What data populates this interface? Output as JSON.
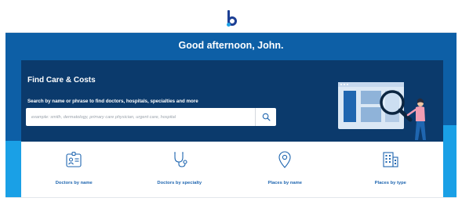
{
  "header": {
    "logo_text": "b"
  },
  "hero": {
    "greeting": "Good afternoon, John."
  },
  "find_care": {
    "title": "Find Care & Costs",
    "subtitle": "Search by name or phrase to find doctors, hospitals, specialties and more",
    "search_placeholder": "example: smith, dermatology, primary care physician, urgent care, hospital",
    "search_icon": "search-icon"
  },
  "categories": [
    {
      "label": "Doctors by name",
      "icon": "id-badge-icon"
    },
    {
      "label": "Doctors by specialty",
      "icon": "stethoscope-icon"
    },
    {
      "label": "Places by name",
      "icon": "map-pin-icon"
    },
    {
      "label": "Places by type",
      "icon": "building-icon"
    }
  ],
  "colors": {
    "brand_blue": "#1c3f94",
    "hero_blue": "#0d5fa6",
    "panel_navy": "#0b3a6c",
    "accent_cyan": "#1aa0e6",
    "link_blue": "#1f66b0"
  }
}
